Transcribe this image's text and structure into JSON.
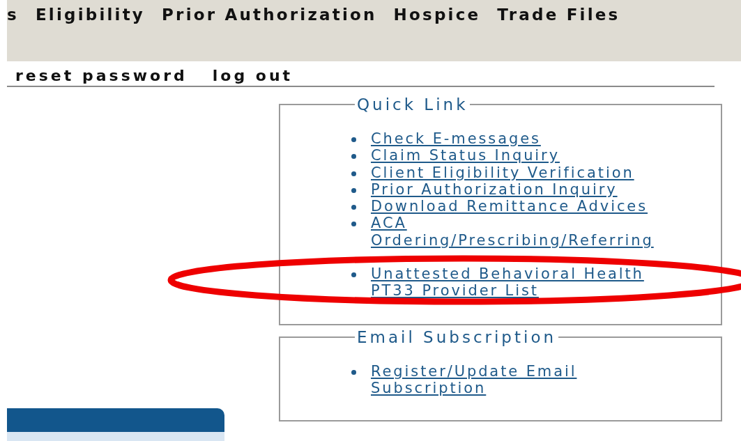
{
  "nav": {
    "items": [
      "s",
      "Eligibility",
      "Prior Authorization",
      "Hospice",
      "Trade Files"
    ]
  },
  "account_links": [
    "reset password",
    "log out"
  ],
  "quick_links": {
    "title": "Quick Link",
    "items": [
      {
        "label": "Check E-messages",
        "circled": false
      },
      {
        "label": "Claim Status Inquiry",
        "circled": false
      },
      {
        "label": "Client Eligibility Verification",
        "circled": false
      },
      {
        "label": "Prior Authorization Inquiry",
        "circled": false
      },
      {
        "label": "Download Remittance Advices",
        "circled": false
      },
      {
        "label": "ACA Ordering/Prescribing/Referring",
        "circled": false
      },
      {
        "label": "Unattested Behavioral Health PT33 Provider List",
        "circled": true
      }
    ]
  },
  "email_subscription": {
    "title": "Email Subscription",
    "items": [
      {
        "label": "Register/Update Email Subscription"
      }
    ]
  }
}
